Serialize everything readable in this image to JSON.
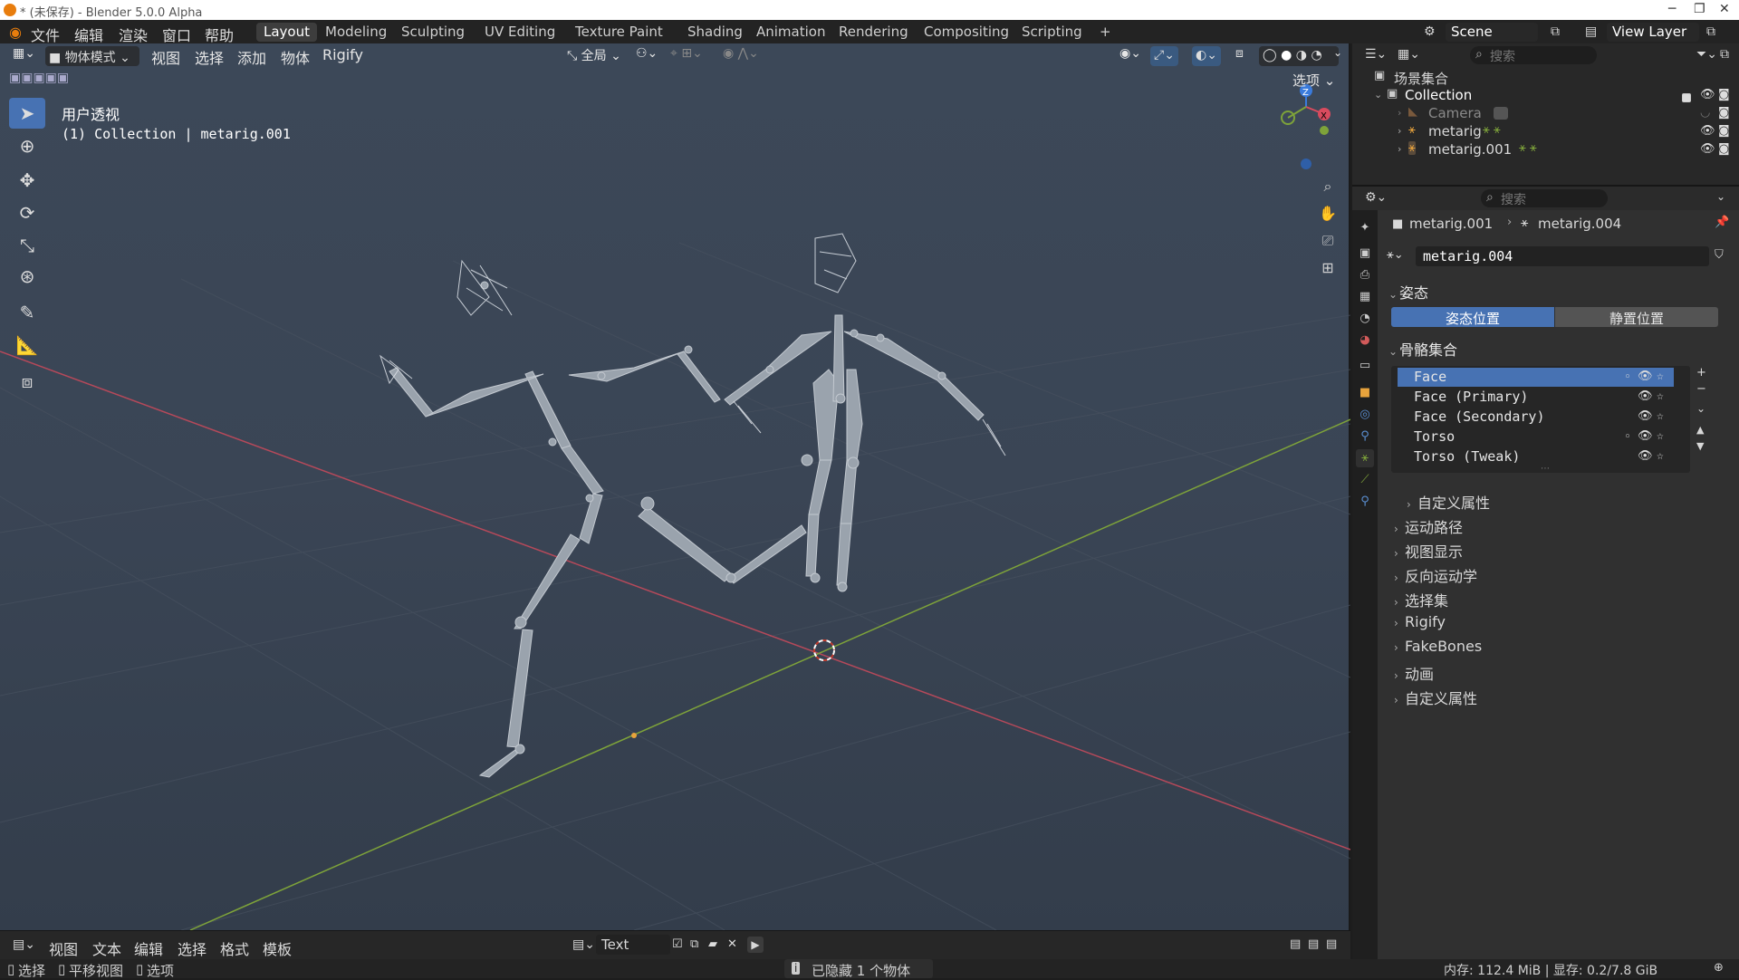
{
  "titlebar": {
    "title": "* (未保存) - Blender 5.0.0 Alpha"
  },
  "menu": [
    "文件",
    "编辑",
    "渲染",
    "窗口",
    "帮助"
  ],
  "workspaces": [
    "Layout",
    "Modeling",
    "Sculpting",
    "UV Editing",
    "Texture Paint",
    "Shading",
    "Animation",
    "Rendering",
    "Compositing",
    "Scripting",
    "+"
  ],
  "scene": "Scene",
  "view_layer": "View Layer",
  "viewport": {
    "mode": "物体模式",
    "menus": [
      "视图",
      "选择",
      "添加",
      "物体",
      "Rigify"
    ],
    "transform": "全局",
    "options": "选项",
    "view_name": "用户透视",
    "context": "(1) Collection | metarig.001"
  },
  "tools": [
    "select-box",
    "cursor",
    "move",
    "rotate",
    "scale",
    "transform",
    "annotate",
    "measure",
    "add-cube"
  ],
  "outliner": {
    "search_placeholder": "搜索",
    "root": "场景集合",
    "collection": "Collection",
    "items": [
      "Camera",
      "metarig",
      "metarig.001"
    ]
  },
  "properties": {
    "search_placeholder": "搜索",
    "breadcrumb_obj": "metarig.001",
    "breadcrumb_arm": "metarig.004",
    "armature_name": "metarig.004",
    "pose_section": "姿态",
    "pose_btn": "姿态位置",
    "rest_btn": "静置位置",
    "bone_collections": "骨骼集合",
    "collections": [
      "Face",
      "Face (Primary)",
      "Face (Secondary)",
      "Torso",
      "Torso (Tweak)"
    ],
    "custom_props_sub": "自定义属性",
    "sections": [
      "运动路径",
      "视图显示",
      "反向运动学",
      "选择集",
      "Rigify",
      "FakeBones",
      "动画",
      "自定义属性"
    ]
  },
  "text_editor": {
    "menus": [
      "视图",
      "文本",
      "编辑",
      "选择",
      "格式",
      "模板"
    ],
    "datablock": "Text"
  },
  "status": {
    "left": [
      "选择",
      "平移视图",
      "选项"
    ],
    "center": "已隐藏 1 个物体",
    "right": "内存: 112.4 MiB | 显存: 0.2/7.8 GiB"
  },
  "colors": {
    "accent": "#4772b3",
    "x_axis": "#b5495a",
    "y_axis": "#7ea33a",
    "bone": "#9aa3ad"
  }
}
